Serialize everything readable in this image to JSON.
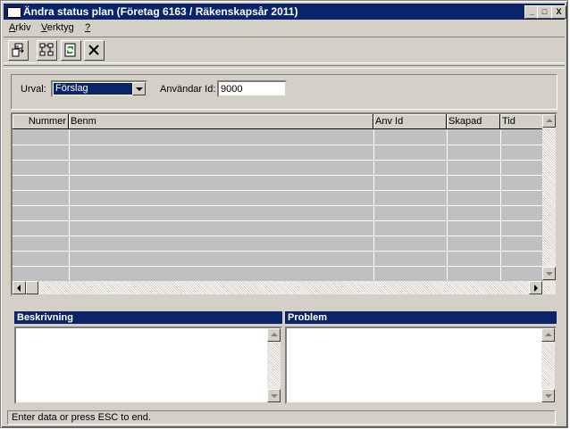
{
  "window": {
    "title": "Ändra status plan (Företag 6163 / Räkenskapsår 2011)"
  },
  "title_buttons": {
    "minimize": "_",
    "maximize": "□",
    "close": "X"
  },
  "menu": [
    {
      "label": "Arkiv",
      "accel": "A",
      "rest": "rkiv"
    },
    {
      "label": "Verktyg",
      "accel": "V",
      "rest": "erktyg"
    },
    {
      "label": "?",
      "accel": "?",
      "rest": ""
    }
  ],
  "toolbar": {
    "buttons": [
      {
        "icon": "export-icon"
      },
      {
        "icon": "tree-structure-icon"
      },
      {
        "icon": "refresh-icon"
      },
      {
        "icon": "delete-x-icon"
      }
    ]
  },
  "filter": {
    "urval_label": "Urval:",
    "urval_value": "Förslag",
    "user_id_label": "Användar Id:",
    "user_id_value": "9000"
  },
  "grid": {
    "columns": [
      "Nummer",
      "Benm",
      "Anv Id",
      "Skapad",
      "Tid"
    ],
    "rows": []
  },
  "panes": {
    "description_title": "Beskrivning",
    "problem_title": "Problem"
  },
  "status": {
    "text": "Enter data or press ESC to end."
  },
  "colors": {
    "title_bg": "#0a246a",
    "face": "#d4d0c8"
  }
}
